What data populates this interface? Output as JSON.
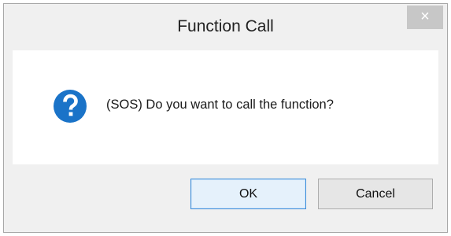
{
  "dialog": {
    "title": "Function Call",
    "close_symbol": "×",
    "icon": "question-icon",
    "message": "(SOS) Do you want to call the function?",
    "buttons": {
      "ok_label": "OK",
      "cancel_label": "Cancel"
    }
  },
  "colors": {
    "icon_blue": "#1a73c8",
    "ok_border": "#3b8ddb",
    "close_button": "#c7c7c7"
  }
}
